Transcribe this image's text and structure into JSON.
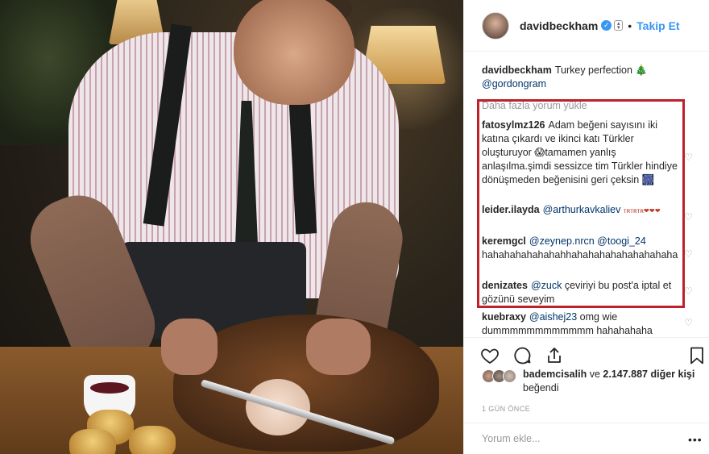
{
  "post": {
    "username": "davidbeckham",
    "follow_label": "Takip Et",
    "caption_user": "davidbeckham",
    "caption_text": "Turkey perfection 🎄",
    "caption_mention": "@gordongram",
    "load_more": "Daha fazla yorum yükle"
  },
  "comments": [
    {
      "user": "fatosylmz126",
      "text": "Adam beğeni sayısını iki katına çıkardı ve ikinci katı Türkler oluşturuyor 😱tamamen yanlış anlaşılma.şimdi sessizce tim Türkler hindiye dönüşmeden beğenisini geri çeksin 🎆"
    },
    {
      "user": "leider.ilayda",
      "mention": "@arthurkavkaliev",
      "text": "ᴛʀᴛʀᴛʀ❤❤❤"
    },
    {
      "user": "keremgcl",
      "mention": "@zeynep.nrcn @toogi_24",
      "text": "hahahahahahahahhahahahahahahahahaha"
    },
    {
      "user": "denizates",
      "mention": "@zuck",
      "text": "çeviriyi bu post'a iptal et gözünü seveyim"
    },
    {
      "user": "kuebraxy",
      "mention": "@aishej23",
      "text": "omg wie dummmmmmmmmmmm hahahahaha"
    }
  ],
  "likes": {
    "user": "bademcisalih",
    "connector": "ve",
    "count_text": "2.147.887 diğer kişi",
    "suffix": "beğendi"
  },
  "timestamp": "1 GÜN ÖNCE",
  "add_comment": {
    "placeholder": "Yorum ekle..."
  },
  "icons": [
    "verified-icon",
    "heart-icon",
    "comment-icon",
    "share-icon",
    "bookmark-icon",
    "more-icon"
  ],
  "colors": {
    "accent": "#3897f0",
    "highlight_box": "#c0202a",
    "mention": "#003569",
    "muted": "#999999"
  }
}
